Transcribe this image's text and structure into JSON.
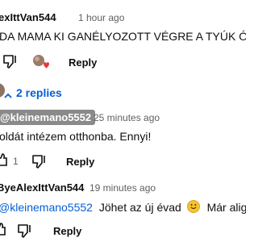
{
  "comment1": {
    "author": "exIttVan544",
    "time": "1 hour ago",
    "text": "DA MAMA KI GANÉLYOZOTT VÉGRE A TYÚK ÓLB",
    "reply_label": "Reply",
    "heart_color": "#e53935"
  },
  "replies_toggle": {
    "label": "2 replies"
  },
  "reply1": {
    "author": "@kleinemano5552",
    "time": "25 minutes ago",
    "text": "oldát intézem otthonba. Ennyi!",
    "like_count": "1",
    "reply_label": "Reply"
  },
  "reply2": {
    "author": "ByeAlexIttVan544",
    "time": "19 minutes ago",
    "mention": "@kleinemano5552",
    "text_before_emoji": "Jöhet az új évad",
    "text_after_emoji": "Már alig v",
    "reply_label": "Reply"
  },
  "colors": {
    "link": "#065fd4",
    "chip_bg": "#8a8a8a",
    "secondary_text": "#606060"
  }
}
